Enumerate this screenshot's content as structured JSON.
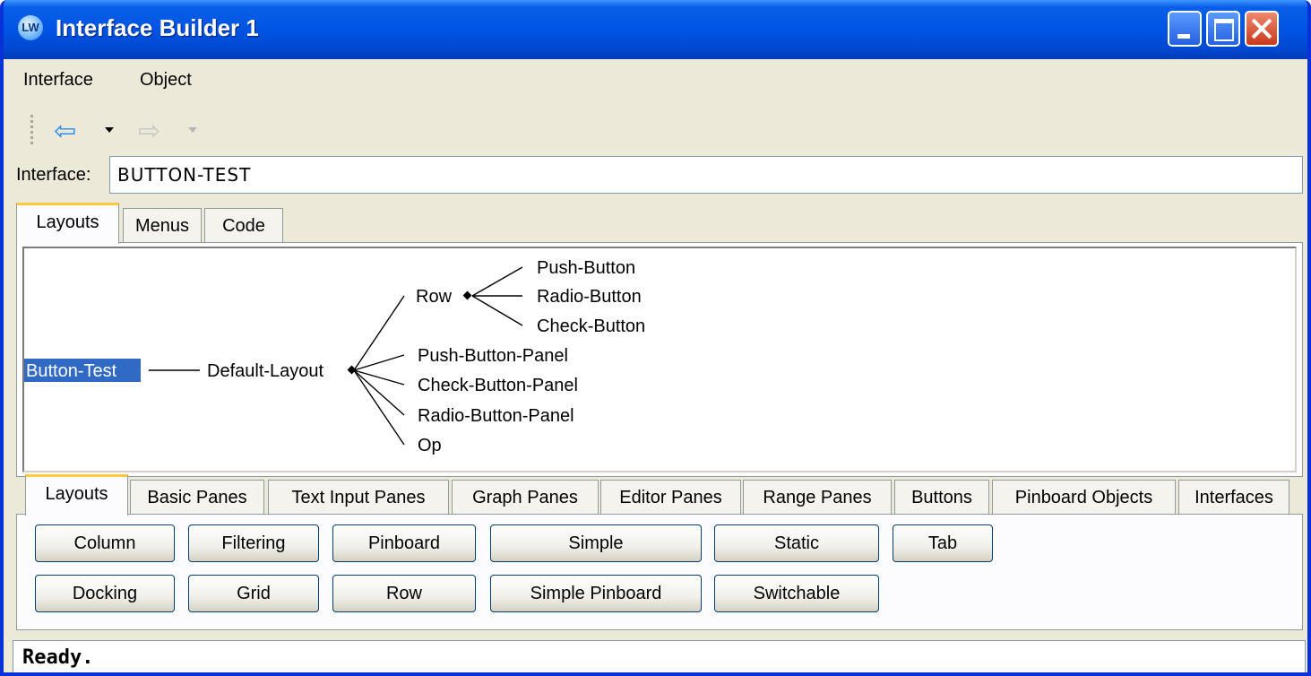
{
  "window": {
    "title": "Interface Builder 1",
    "app_icon": "LW"
  },
  "menubar": {
    "items": [
      "Interface",
      "Object"
    ]
  },
  "toolbar": {
    "back_icon": "back-arrow-icon",
    "forward_icon": "forward-arrow-icon",
    "forward_enabled": false
  },
  "interface": {
    "label": "Interface:",
    "value": "BUTTON-TEST"
  },
  "top_tabs": {
    "items": [
      "Layouts",
      "Menus",
      "Code"
    ],
    "active": "Layouts"
  },
  "graph": {
    "root": "Button-Test",
    "layout": "Default-Layout",
    "row": "Row",
    "row_children": [
      "Push-Button",
      "Radio-Button",
      "Check-Button"
    ],
    "layout_children": [
      "Push-Button-Panel",
      "Check-Button-Panel",
      "Radio-Button-Panel",
      "Op"
    ],
    "selected": "Button-Test"
  },
  "palette_tabs": {
    "items": [
      "Layouts",
      "Basic Panes",
      "Text Input Panes",
      "Graph Panes",
      "Editor Panes",
      "Range Panes",
      "Buttons",
      "Pinboard Objects",
      "Interfaces"
    ],
    "active": "Layouts"
  },
  "palette_buttons": {
    "row1": [
      "Column",
      "Filtering",
      "Pinboard",
      "Simple",
      "Static",
      "Tab"
    ],
    "row2": [
      "Docking",
      "Grid",
      "Row",
      "Simple Pinboard",
      "Switchable"
    ]
  },
  "status": {
    "text": "Ready."
  }
}
